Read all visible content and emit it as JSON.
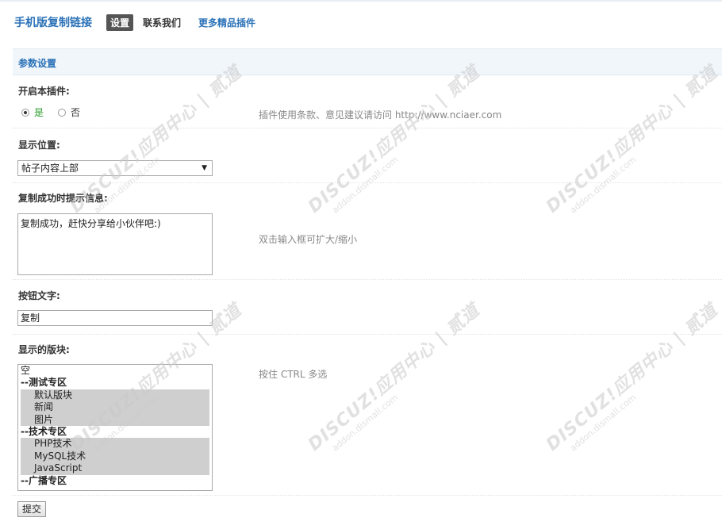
{
  "header": {
    "app_title": "手机版复制链接",
    "tabs": [
      {
        "label": "设置"
      },
      {
        "label": "联系我们"
      },
      {
        "label": "更多精品插件"
      }
    ]
  },
  "section": {
    "title": "参数设置"
  },
  "fields": {
    "enable": {
      "label": "开启本插件:",
      "options": [
        "是",
        "否"
      ],
      "selected": "是",
      "hint": "插件使用条款、意见建议请访问 http://www.nciaer.com"
    },
    "position": {
      "label": "显示位置:",
      "value": "帖子内容上部"
    },
    "success_msg": {
      "label": "复制成功时提示信息:",
      "value": "复制成功，赶快分享给小伙伴吧:)",
      "hint": "双击输入框可扩大/缩小"
    },
    "button_text": {
      "label": "按钮文字:",
      "value": "复制"
    },
    "forums": {
      "label": "显示的版块:",
      "hint": "按住 CTRL 多选",
      "options": [
        {
          "label": "空",
          "type": "option",
          "selected": false
        },
        {
          "label": "--测试专区",
          "type": "group",
          "selected": false
        },
        {
          "label": "默认版块",
          "type": "child",
          "selected": true
        },
        {
          "label": "新闻",
          "type": "child",
          "selected": true
        },
        {
          "label": "图片",
          "type": "child",
          "selected": true
        },
        {
          "label": "--技术专区",
          "type": "group",
          "selected": false
        },
        {
          "label": "PHP技术",
          "type": "child",
          "selected": true
        },
        {
          "label": "MySQL技术",
          "type": "child",
          "selected": true
        },
        {
          "label": "JavaScript",
          "type": "child",
          "selected": true
        },
        {
          "label": "--广播专区",
          "type": "group",
          "selected": false
        }
      ]
    }
  },
  "submit_label": "提交",
  "watermark": {
    "line1": "DISCUZ!应用中心 | 贰道",
    "line2": "addon.dismall.com"
  }
}
